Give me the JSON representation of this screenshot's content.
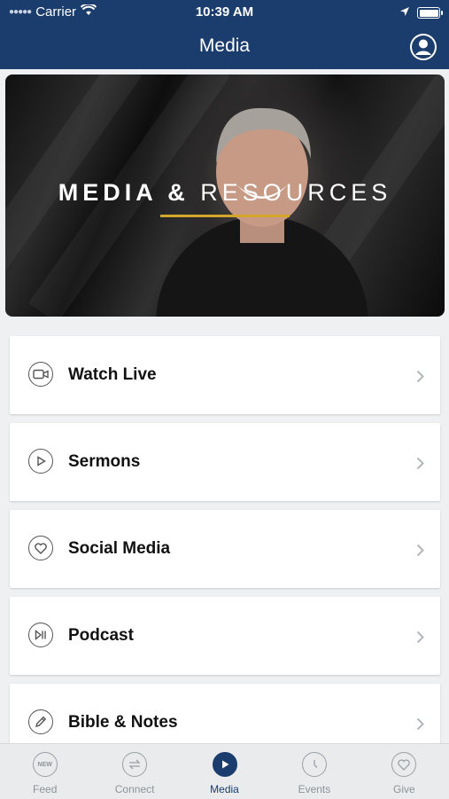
{
  "status_bar": {
    "carrier": "Carrier",
    "time": "10:39 AM"
  },
  "nav": {
    "title": "Media"
  },
  "hero": {
    "title_bold": "MEDIA &",
    "title_light": "RESOURCES"
  },
  "menu": [
    {
      "label": "Watch Live",
      "icon": "video-camera-icon"
    },
    {
      "label": "Sermons",
      "icon": "play-icon"
    },
    {
      "label": "Social Media",
      "icon": "heart-icon"
    },
    {
      "label": "Podcast",
      "icon": "play-pause-icon"
    },
    {
      "label": "Bible & Notes",
      "icon": "pencil-icon"
    }
  ],
  "tabs": [
    {
      "label": "Feed",
      "icon": "new-badge-icon",
      "badge": "NEW"
    },
    {
      "label": "Connect",
      "icon": "connect-arrows-icon"
    },
    {
      "label": "Media",
      "icon": "play-icon",
      "active": true
    },
    {
      "label": "Events",
      "icon": "clock-icon"
    },
    {
      "label": "Give",
      "icon": "heart-icon"
    }
  ],
  "colors": {
    "primary": "#1b3d6d",
    "accent": "#d4a62a",
    "inactive": "#8d9399"
  }
}
